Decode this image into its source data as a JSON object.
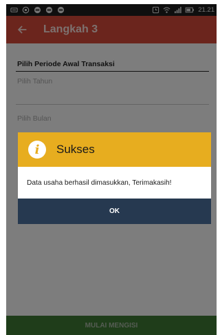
{
  "status_bar": {
    "time": "21.21",
    "icons": [
      "screenshot-icon",
      "whatsapp-icon",
      "chat-bubble-icon",
      "chat-bubble-icon",
      "chat-bubble-icon",
      "alarm-icon",
      "wifi-icon",
      "signal-icon",
      "battery-icon"
    ]
  },
  "app_bar": {
    "back_icon": "arrow-left-icon",
    "title": "Langkah 3"
  },
  "form": {
    "section_title": "Pilih Periode Awal Transaksi",
    "year_placeholder": "Pilih Tahun",
    "month_placeholder": "Pilih Bulan"
  },
  "dialog": {
    "icon": "info-icon",
    "icon_glyph": "i",
    "title": "Sukses",
    "message": "Data usaha berhasil dimasukkan, Terimakasih!",
    "ok_label": "OK"
  },
  "bottom": {
    "button_label": "MULAI MENGISI"
  },
  "colors": {
    "app_bar": "#d64a3a",
    "dialog_header": "#e7ad1f",
    "ok_button": "#263950",
    "bottom_button": "#3e7a34"
  }
}
